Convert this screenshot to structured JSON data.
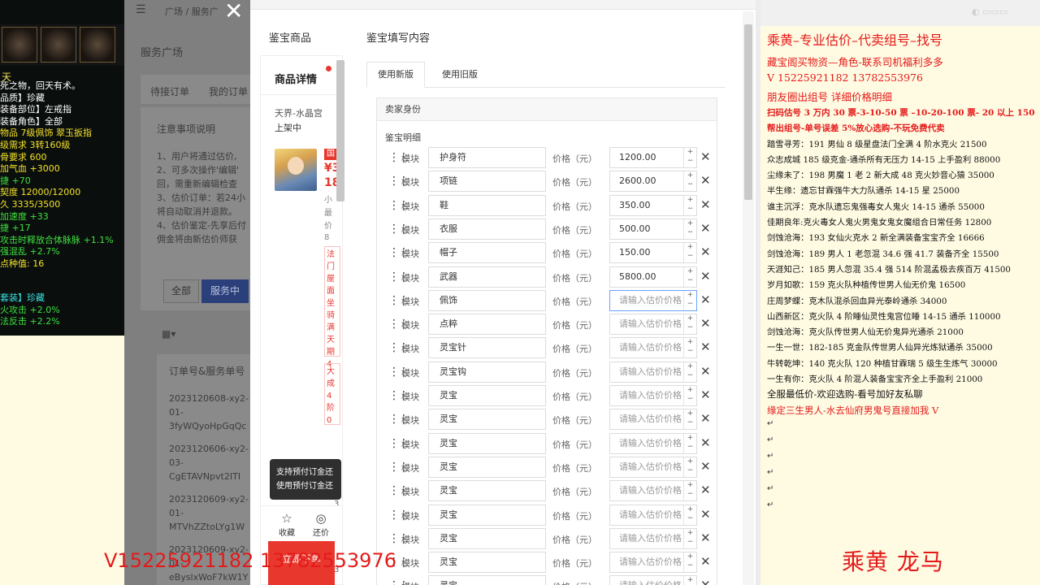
{
  "game": {
    "title": "天",
    "lines": [
      {
        "t": "死之物，回天有术。",
        "c": "w"
      },
      {
        "t": "品质】珍藏",
        "c": "w"
      },
      {
        "t": "装备部位】左戒指",
        "c": "w"
      },
      {
        "t": "装备角色】全部",
        "c": "w"
      },
      {
        "t": "物品 7级佩饰 翠玉扳指",
        "c": "y"
      },
      {
        "t": "级需求 3转160级",
        "c": "y"
      },
      {
        "t": "骨要求 600",
        "c": "y"
      },
      {
        "t": "加气血 +3000",
        "c": "y"
      },
      {
        "t": "捷 +70",
        "c": "g"
      },
      {
        "t": "契度 12000/12000",
        "c": "y"
      },
      {
        "t": "久 3335/3500",
        "c": "y"
      },
      {
        "t": "加速度 +33",
        "c": "g"
      },
      {
        "t": "捷 +17",
        "c": "g"
      },
      {
        "t": "攻击时释放合体脉脉 +1.1%",
        "c": "g"
      },
      {
        "t": "强混乱 +2.7%",
        "c": "g"
      },
      {
        "t": "点种值: 16",
        "c": "y"
      }
    ],
    "set_lines": [
      {
        "t": "套装】珍藏",
        "c": "c"
      },
      {
        "t": "火攻击 +2.0%",
        "c": "g"
      },
      {
        "t": "法反击 +2.2%",
        "c": "g"
      }
    ]
  },
  "bg_app": {
    "breadcrumb": "广场 / 服务广",
    "section": "服务广场",
    "tab_pending": "待接订单",
    "tab_mine": "我的订单",
    "notes_title": "注意事项说明",
    "note_lines": [
      "1、用户将通过估价,",
      "2、可多次操作'编辑'",
      "回，需重新编辑检查",
      "3、估价订单：若24小",
      "将自动取消并退款。",
      "4、估价鉴定-先享后付",
      "佣金将由新估价师获"
    ],
    "btn_all": "全部",
    "btn_serving": "服务中",
    "col_order": "订单号&服务单号",
    "orders": [
      "2023120608-xy2-",
      "01-",
      "3fyWQyoHpGqQc",
      "2023120606-xy2-",
      "03-",
      "CgETAVNpvt2ITI",
      "2023120609-xy2-",
      "01-",
      "MTVhZZtoLYg1W",
      "2023120609-xy2-",
      "01-",
      "eByslxWoF7kW1Y"
    ]
  },
  "dialog": {
    "tab_product": "鉴宝商品",
    "tab_fill": "鉴宝填写内容",
    "product": {
      "header": "商品详情",
      "server": "天界-水晶宫",
      "status": "上架中",
      "tag": "国",
      "price1": "¥3",
      "price2": "18",
      "small": [
        "小",
        "最",
        "价",
        "8"
      ],
      "box1": "法门屋面坐骑满天期4",
      "box2": "大成4阶0",
      "num3a": "3",
      "num3b": "3"
    },
    "tooltip": [
      "支持预付订金还",
      "使用预付订金还"
    ],
    "fav": "收藏",
    "bargain": "还价",
    "buy": "立即下单",
    "version_new": "使用新版",
    "version_old": "使用旧版",
    "seller_identity": "卖家身份",
    "detail_title": "鉴宝明细",
    "module_label": "模块",
    "price_label": "价格（元）",
    "placeholder": "请输入估价价格",
    "rows": [
      {
        "name": "护身符",
        "price": "1200.00"
      },
      {
        "name": "项链",
        "price": "2600.00"
      },
      {
        "name": "鞋",
        "price": "350.00"
      },
      {
        "name": "衣服",
        "price": "500.00"
      },
      {
        "name": "帽子",
        "price": "150.00"
      },
      {
        "name": "武器",
        "price": "5800.00"
      },
      {
        "name": "佩饰",
        "price": ""
      },
      {
        "name": "点粹",
        "price": ""
      },
      {
        "name": "灵宝针",
        "price": ""
      },
      {
        "name": "灵宝钩",
        "price": ""
      },
      {
        "name": "灵宝",
        "price": ""
      },
      {
        "name": "灵宝",
        "price": ""
      },
      {
        "name": "灵宝",
        "price": ""
      },
      {
        "name": "灵宝",
        "price": ""
      },
      {
        "name": "灵宝",
        "price": ""
      },
      {
        "name": "灵宝",
        "price": ""
      },
      {
        "name": "灵宝",
        "price": ""
      },
      {
        "name": "灵宝",
        "price": ""
      },
      {
        "name": "灵宝",
        "price": ""
      }
    ]
  },
  "info": {
    "title": "乘黄–专业估价–代卖组号–找号",
    "lines": [
      {
        "t": "藏宝阁买物资—角色-联系司机福利多多",
        "c": "red",
        "s": "s13"
      },
      {
        "t": "V 15225921182    13782553976",
        "c": "red",
        "s": "s13"
      },
      {
        "t": "朋友圈出组号    详细价格明细",
        "c": "red",
        "s": "s13"
      },
      {
        "t": "扫码估号 3 万内 30 票-3-10-50 票  –10-20-100 票- 20 以上 150",
        "c": "red",
        "s": "s11"
      },
      {
        "t": "帮出组号-单号误差 5%放心选购-不玩免费代卖",
        "c": "red",
        "s": "s11"
      },
      {
        "t": "踏雪寻芳：191 男仙 8 级星盘法门全满 4 阶水克火 21500",
        "c": "blk",
        "s": "s10"
      },
      {
        "t": "众志成城  185 级克金-通杀所有无压力 14-15 上手盈利 88000",
        "c": "blk",
        "s": "s10"
      },
      {
        "t": "尘缘未了：198 男魔 1 老 2 新大成 48 克火妙音心猿 35000",
        "c": "blk",
        "s": "s10"
      },
      {
        "t": "半生缘：遗忘甘霖强牛大力队通杀 14-15 星 25000",
        "c": "blk",
        "s": "s10"
      },
      {
        "t": "谁主沉浮：克水队遗忘鬼强毒女人鬼火 14-15 通杀 55000",
        "c": "blk",
        "s": "s10"
      },
      {
        "t": "佳期良年:克火毒女人鬼火男鬼女鬼女魔组合日常任务 12800",
        "c": "blk",
        "s": "s10"
      },
      {
        "t": "剑蚀沧海：193 女仙火克水 2 新全满装备宝宝齐全 16666",
        "c": "blk",
        "s": "s10"
      },
      {
        "t": "剑蚀沧海：189 男人 1 老忽混 34.6 强 41.7 装备齐全 15500",
        "c": "blk",
        "s": "s10"
      },
      {
        "t": "天涯知己：185 男人忽混 35.4 强 514 阶混孟极去疾百万 41500",
        "c": "blk",
        "s": "s10"
      },
      {
        "t": "岁月如歌：159 克火队种植传世男人仙无价鬼 16500",
        "c": "blk",
        "s": "s10"
      },
      {
        "t": "庄周梦蝶：克木队混杀回血异光泰岭通杀 34000",
        "c": "blk",
        "s": "s10"
      },
      {
        "t": "山西新区：克火队 4 阶睡仙灵性鬼宫位睡 14-15 通杀 110000",
        "c": "blk",
        "s": "s10"
      },
      {
        "t": "剑蚀沧海：克火队传世男人仙无价鬼异光通杀 21000",
        "c": "blk",
        "s": "s10"
      },
      {
        "t": "一生一世：182-185 克金队传世男人仙异光炼狱通杀 35000",
        "c": "blk",
        "s": "s10"
      },
      {
        "t": "牛转乾坤：140 克火队 120 种植甘霖瑞 5 级生生炼气 30000",
        "c": "blk",
        "s": "s10"
      },
      {
        "t": "一生有你：克火队 4 阶混人装备宝宝齐全上手盈利 21000",
        "c": "blk",
        "s": "s10"
      },
      {
        "t": "全服最低价-欢迎选购-看号加好友私聊",
        "c": "blk",
        "s": "s11n"
      },
      {
        "t": "缘定三生男人-水去仙府男鬼号直接加我 V",
        "c": "red",
        "s": "s11n"
      }
    ],
    "sign": "乘黄  龙马"
  },
  "overlay_phone": "V15225921182  13782553976"
}
